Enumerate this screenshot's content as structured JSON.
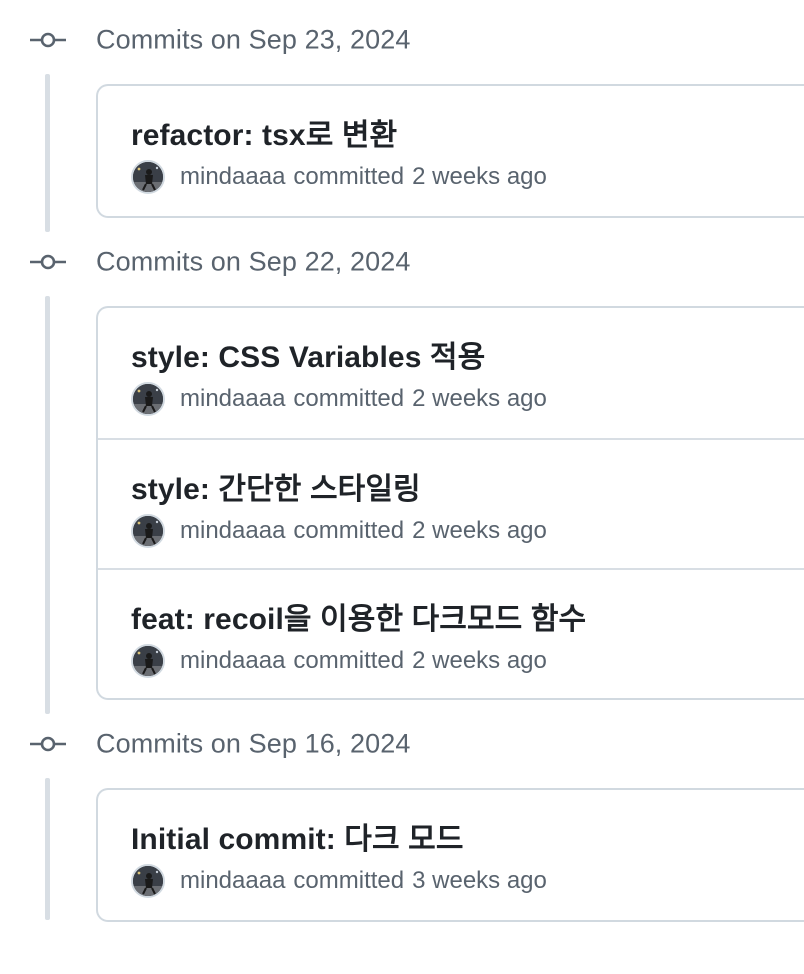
{
  "groups": [
    {
      "title": "Commits on Sep 23, 2024",
      "commits": [
        {
          "message": "refactor: tsx로 변환",
          "author": "mindaaaa",
          "action": "committed",
          "time": "2 weeks ago"
        }
      ]
    },
    {
      "title": "Commits on Sep 22, 2024",
      "commits": [
        {
          "message": "style: CSS Variables 적용",
          "author": "mindaaaa",
          "action": "committed",
          "time": "2 weeks ago"
        },
        {
          "message": "style: 간단한 스타일링",
          "author": "mindaaaa",
          "action": "committed",
          "time": "2 weeks ago"
        },
        {
          "message": "feat: recoil을 이용한 다크모드 함수",
          "author": "mindaaaa",
          "action": "committed",
          "time": "2 weeks ago"
        }
      ]
    },
    {
      "title": "Commits on Sep 16, 2024",
      "commits": [
        {
          "message": "Initial commit: 다크 모드",
          "author": "mindaaaa",
          "action": "committed",
          "time": "3 weeks ago"
        }
      ]
    }
  ],
  "colors": {
    "muted_text": "#59636e",
    "primary_text": "#1f2328",
    "border": "#d1d9e0"
  },
  "icons": {
    "group_node": "git-commit-icon",
    "avatar": "user-avatar"
  }
}
